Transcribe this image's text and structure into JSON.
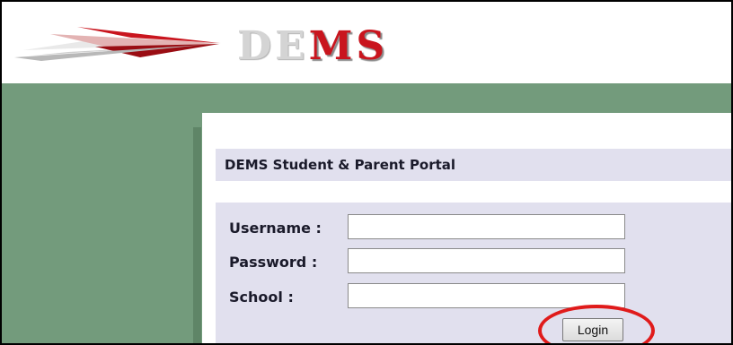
{
  "header": {
    "logo_letters": [
      "D",
      "E",
      "M",
      "S"
    ],
    "brand_red": "#c9151e",
    "logo_grey": "#d4d4d4",
    "icon": "paper-airplane-logo"
  },
  "portal": {
    "title": "DEMS Student & Parent Portal",
    "green": "#739b7c",
    "panel_bg": "#e1e0ee"
  },
  "form": {
    "username_label": "Username :",
    "password_label": "Password :",
    "school_label": "School :",
    "username_value": "",
    "password_value": "",
    "school_value": "",
    "login_label": "Login"
  },
  "annotation": {
    "highlight_color": "#e01b1b",
    "target": "login-button"
  }
}
